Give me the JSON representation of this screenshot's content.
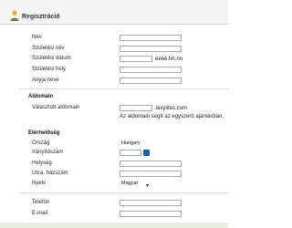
{
  "header": {
    "title": "Regisztráció",
    "icon": "user-icon"
  },
  "personal": {
    "name_label": "Név",
    "birth_name_label": "Születési név",
    "birth_date_label": "Születési dátum",
    "birth_date_hint": "éééé.hh.nn",
    "birth_place_label": "Születési hely",
    "mother_name_label": "Anyja neve"
  },
  "domain": {
    "section_title": "Aldomain",
    "selected_label": "Választott aldomain",
    "suffix": ".lavylites.com",
    "help_text": "Az aldomain segít az egyszerű ajánlásban."
  },
  "address": {
    "section_title": "Elérhetőség",
    "country_label": "Ország",
    "country_value": "Hungary",
    "zip_label": "Irányítószám",
    "city_label": "Helység",
    "street_label": "Utca, házszám",
    "language_label": "Nyelv",
    "language_value": "Magyar"
  },
  "contact": {
    "phone_label": "Telefon",
    "email_label": "E-mail"
  },
  "colors": {
    "accent": "#1e5fa8",
    "header_bg": "#f4f4f4",
    "footer": "#e8f0e4"
  }
}
